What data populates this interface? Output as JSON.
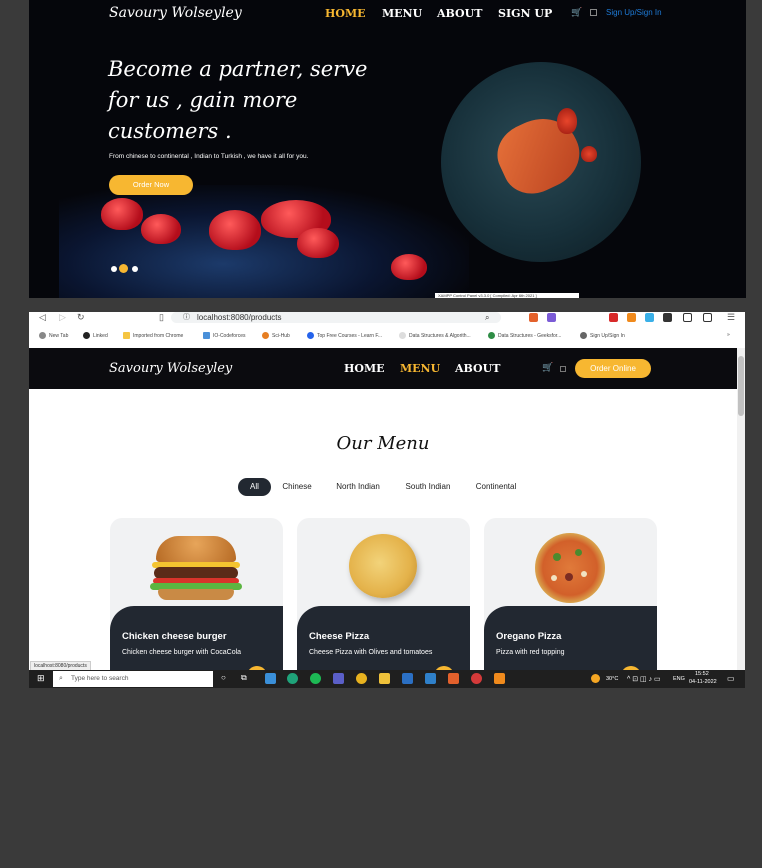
{
  "hero": {
    "logo": "Savoury Wolseyley",
    "nav": [
      "HOME",
      "MENU",
      "ABOUT",
      "SIGN UP"
    ],
    "signin": "Sign Up/Sign In",
    "headline": "Become a partner, serve for us , gain more customers .",
    "tagline": "From chinese to continental , Indian to Turkish , we have it all for you.",
    "order_btn": "Order Now",
    "status_strip": "XAMPP Control Panel v3.3.0 [ Compiled: Apr 6th 2021 ]",
    "active_color": "#f7b731"
  },
  "browser": {
    "url": "localhost:8080/products",
    "bookmarks": [
      "New Tab",
      "Linked",
      "Imported from Chrome",
      "IO-Codeforces",
      "Sci-Hub",
      "Top Free Courses - Learn F...",
      "Data Structures & Algorith...",
      "Data Structures - Geeksfor...",
      "Sign Up/Sign In"
    ]
  },
  "site": {
    "logo": "Savoury Wolseyley",
    "nav": [
      "HOME",
      "MENU",
      "ABOUT"
    ],
    "order_btn": "Order Online",
    "menu_title": "Our Menu",
    "filters": [
      "All",
      "Chinese",
      "North Indian",
      "South Indian",
      "Continental"
    ],
    "cards": [
      {
        "name": "Chicken cheese burger",
        "desc": "Chicken cheese burger with CocaCola",
        "icon": "burger-image"
      },
      {
        "name": "Cheese Pizza",
        "desc": "Cheese Pizza with Olives and tomatoes",
        "icon": "cheese-pizza-image"
      },
      {
        "name": "Oregano Pizza",
        "desc": "Pizza with red topping",
        "icon": "oregano-pizza-image"
      }
    ],
    "hover_url": "localhost:8080/products"
  },
  "taskbar": {
    "search_placeholder": "Type here to search",
    "weather": "30°C",
    "lang": "ENG",
    "time": "15:52",
    "date": "04-11-2022"
  }
}
